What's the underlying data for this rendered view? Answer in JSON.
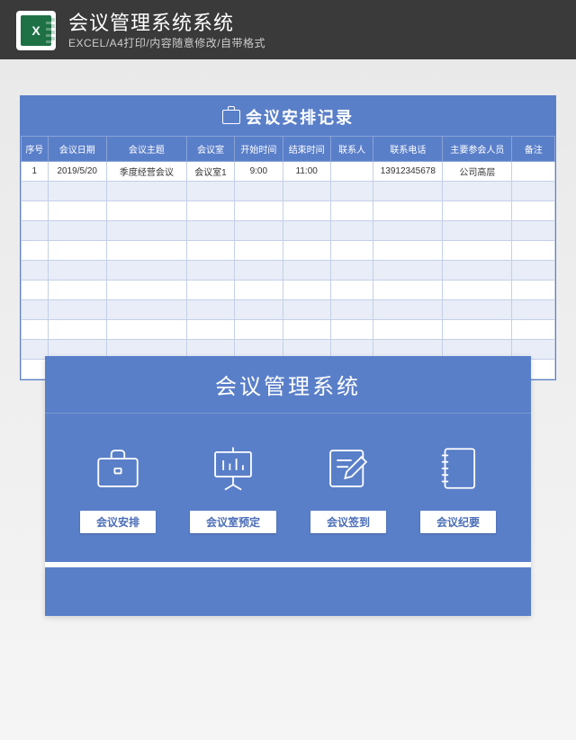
{
  "header": {
    "logo_text": "X",
    "title": "会议管理系统系统",
    "subtitle": "EXCEL/A4打印/内容随意修改/自带格式"
  },
  "sheet": {
    "title": "会议安排记录",
    "columns": [
      "序号",
      "会议日期",
      "会议主题",
      "会议室",
      "开始时间",
      "结束时间",
      "联系人",
      "联系电话",
      "主要参会人员",
      "备注"
    ],
    "col_widths": [
      "5%",
      "11%",
      "15%",
      "9%",
      "9%",
      "9%",
      "8%",
      "13%",
      "13%",
      "8%"
    ],
    "rows": [
      {
        "c": [
          "1",
          "2019/5/20",
          "季度经营会议",
          "会议室1",
          "9:00",
          "11:00",
          "",
          "13912345678",
          "公司高层",
          ""
        ]
      },
      {
        "c": [
          "",
          "",
          "",
          "",
          "",
          "",
          "",
          "",
          "",
          ""
        ]
      },
      {
        "c": [
          "",
          "",
          "",
          "",
          "",
          "",
          "",
          "",
          "",
          ""
        ]
      },
      {
        "c": [
          "",
          "",
          "",
          "",
          "",
          "",
          "",
          "",
          "",
          ""
        ]
      },
      {
        "c": [
          "",
          "",
          "",
          "",
          "",
          "",
          "",
          "",
          "",
          ""
        ]
      },
      {
        "c": [
          "",
          "",
          "",
          "",
          "",
          "",
          "",
          "",
          "",
          ""
        ]
      },
      {
        "c": [
          "",
          "",
          "",
          "",
          "",
          "",
          "",
          "",
          "",
          ""
        ]
      },
      {
        "c": [
          "",
          "",
          "",
          "",
          "",
          "",
          "",
          "",
          "",
          ""
        ]
      },
      {
        "c": [
          "",
          "",
          "",
          "",
          "",
          "",
          "",
          "",
          "",
          ""
        ]
      },
      {
        "c": [
          "",
          "",
          "",
          "",
          "",
          "",
          "",
          "",
          "",
          ""
        ]
      },
      {
        "c": [
          "",
          "",
          "",
          "",
          "",
          "",
          "",
          "",
          "",
          ""
        ]
      }
    ]
  },
  "panel": {
    "title": "会议管理系统",
    "modules": [
      {
        "icon": "briefcase",
        "label": "会议安排"
      },
      {
        "icon": "board",
        "label": "会议室预定"
      },
      {
        "icon": "edit",
        "label": "会议签到"
      },
      {
        "icon": "notebook",
        "label": "会议纪要"
      }
    ]
  }
}
